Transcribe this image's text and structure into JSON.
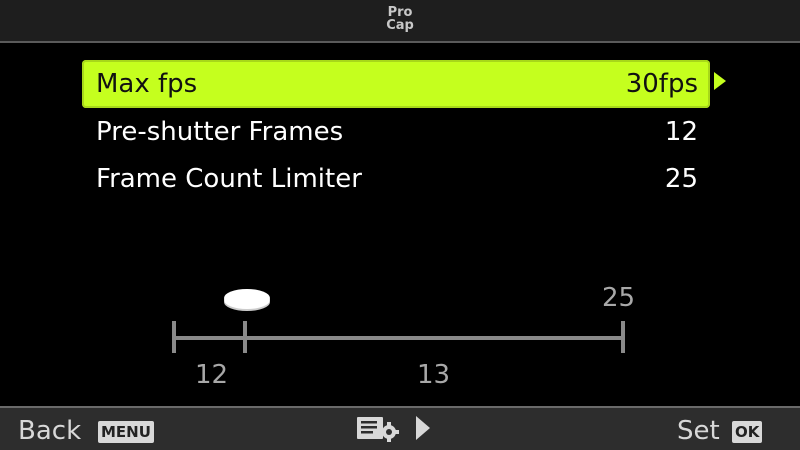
{
  "header": {
    "title_line1": "Pro",
    "title_line2": "Cap"
  },
  "menu": [
    {
      "label": "Max fps",
      "value": "30fps",
      "selected": true
    },
    {
      "label": "Pre-shutter Frames",
      "value": "12",
      "selected": false
    },
    {
      "label": "Frame Count Limiter",
      "value": "25",
      "selected": false
    }
  ],
  "scale": {
    "top_label": "25",
    "pre_label": "12",
    "post_label": "13",
    "icon": "shutter-release-icon"
  },
  "footer": {
    "back_label": "Back",
    "back_badge": "MENU",
    "settings_icon": "menu-settings-icon",
    "set_label": "Set",
    "set_badge": "OK"
  },
  "colors": {
    "highlight": "#c5ff1e",
    "background": "#000000",
    "scale": "#8a8a8a"
  }
}
